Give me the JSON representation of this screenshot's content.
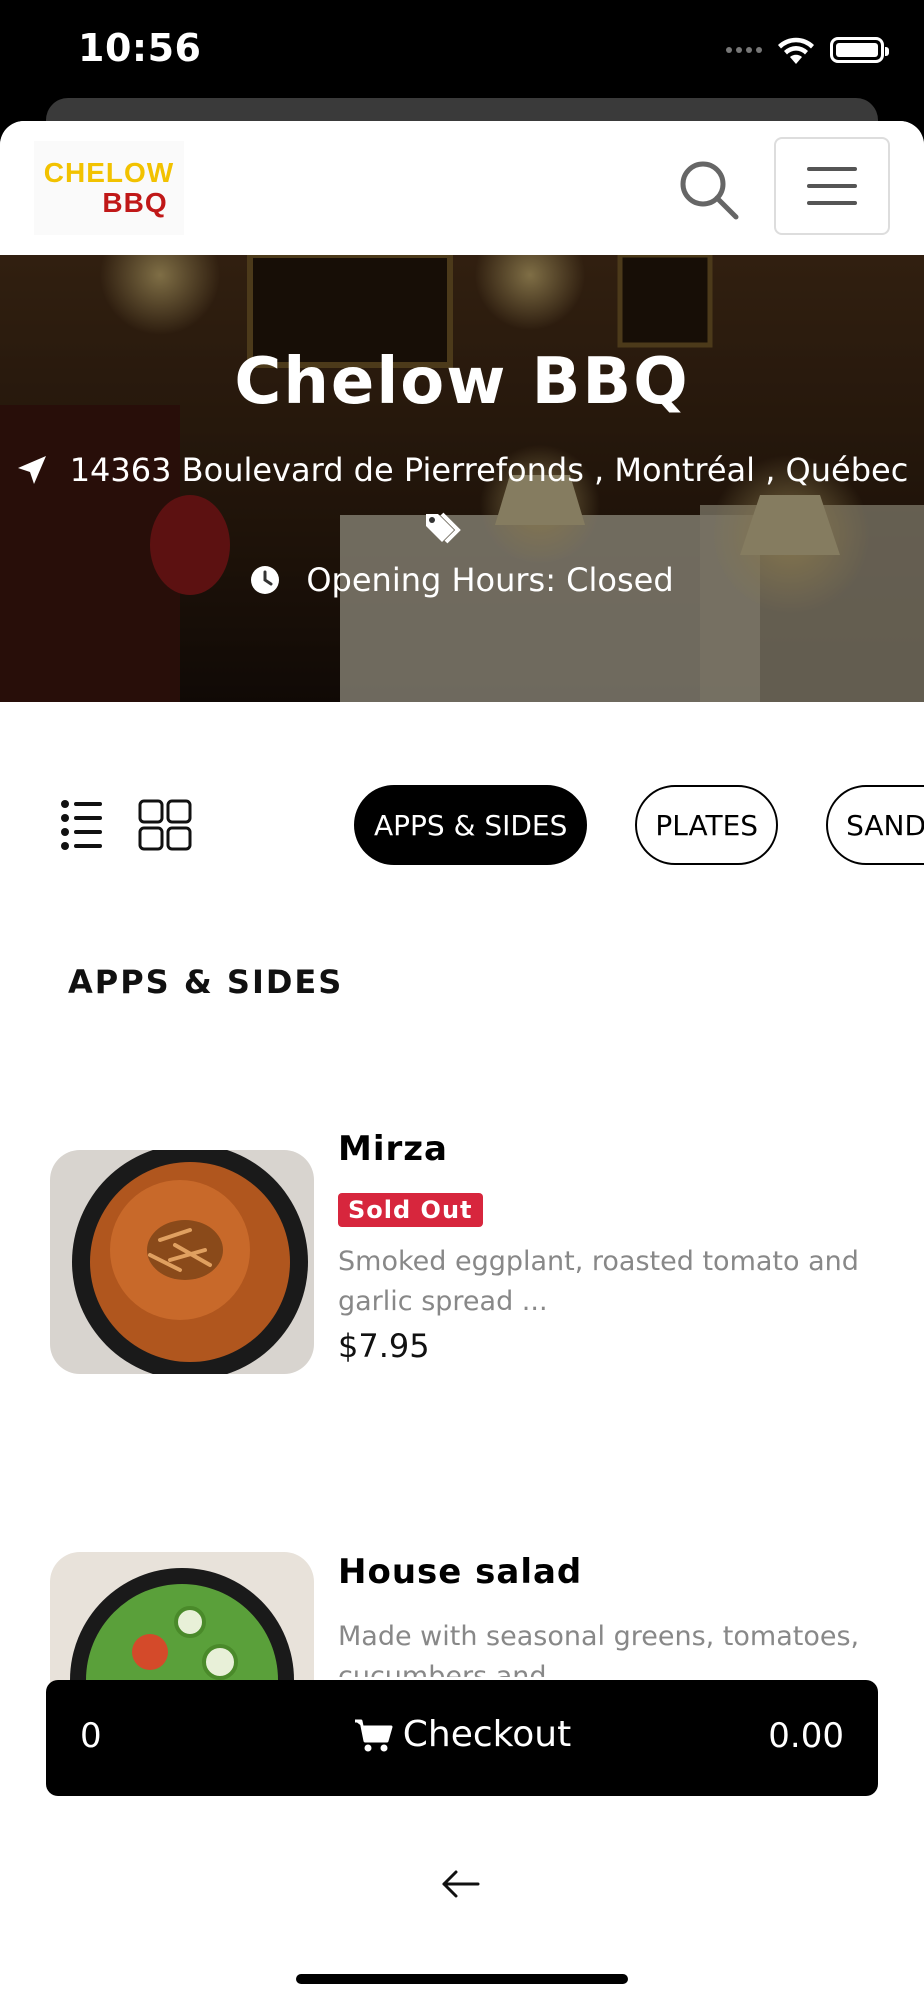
{
  "status_bar": {
    "time": "10:56"
  },
  "header": {
    "logo_line1": "CHELOW",
    "logo_line2": "BBQ"
  },
  "hero": {
    "title": "Chelow BBQ",
    "address": "14363 Boulevard de Pierrefonds , Montréal , Québec",
    "hours": "Opening Hours: Closed"
  },
  "tabs": [
    {
      "label": "APPS & SIDES",
      "active": true
    },
    {
      "label": "PLATES",
      "active": false
    },
    {
      "label": "SANDWICHES",
      "active": false
    }
  ],
  "section": {
    "title": "APPS & SIDES"
  },
  "items": [
    {
      "name": "Mirza",
      "badge": "Sold Out",
      "description": "Smoked eggplant, roasted tomato and garlic spread ...",
      "price": "$7.95"
    },
    {
      "name": "House salad",
      "description": "Made with seasonal greens, tomatoes, cucumbers and ..."
    }
  ],
  "checkout": {
    "count": "0",
    "label": "Checkout",
    "total": "0.00"
  },
  "colors": {
    "brand_yellow": "#f2c200",
    "brand_red": "#c01818",
    "sold_out": "#d7263d"
  }
}
